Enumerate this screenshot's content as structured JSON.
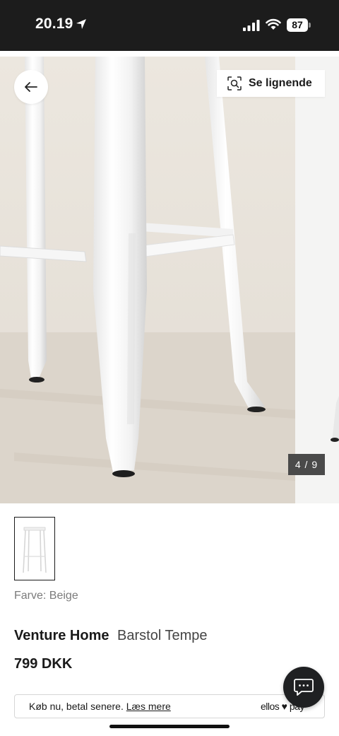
{
  "status_bar": {
    "time": "20.19",
    "battery": "87",
    "icons": [
      "location-arrow-icon",
      "cellular-signal-icon",
      "wifi-icon",
      "battery-icon"
    ]
  },
  "gallery": {
    "back_icon": "arrow-left-icon",
    "similar_icon": "visual-search-icon",
    "similar_label": "Se lignende",
    "counter": "4 / 9"
  },
  "product": {
    "color_label": "Farve: Beige",
    "brand": "Venture Home",
    "name": "Barstol Tempe",
    "price": "799 DKK"
  },
  "payment": {
    "text": "Køb nu, betal senere.",
    "link": "Læs mere",
    "logo": "ellos ♥ pay"
  },
  "chat": {
    "icon": "chat-bubble-icon"
  }
}
